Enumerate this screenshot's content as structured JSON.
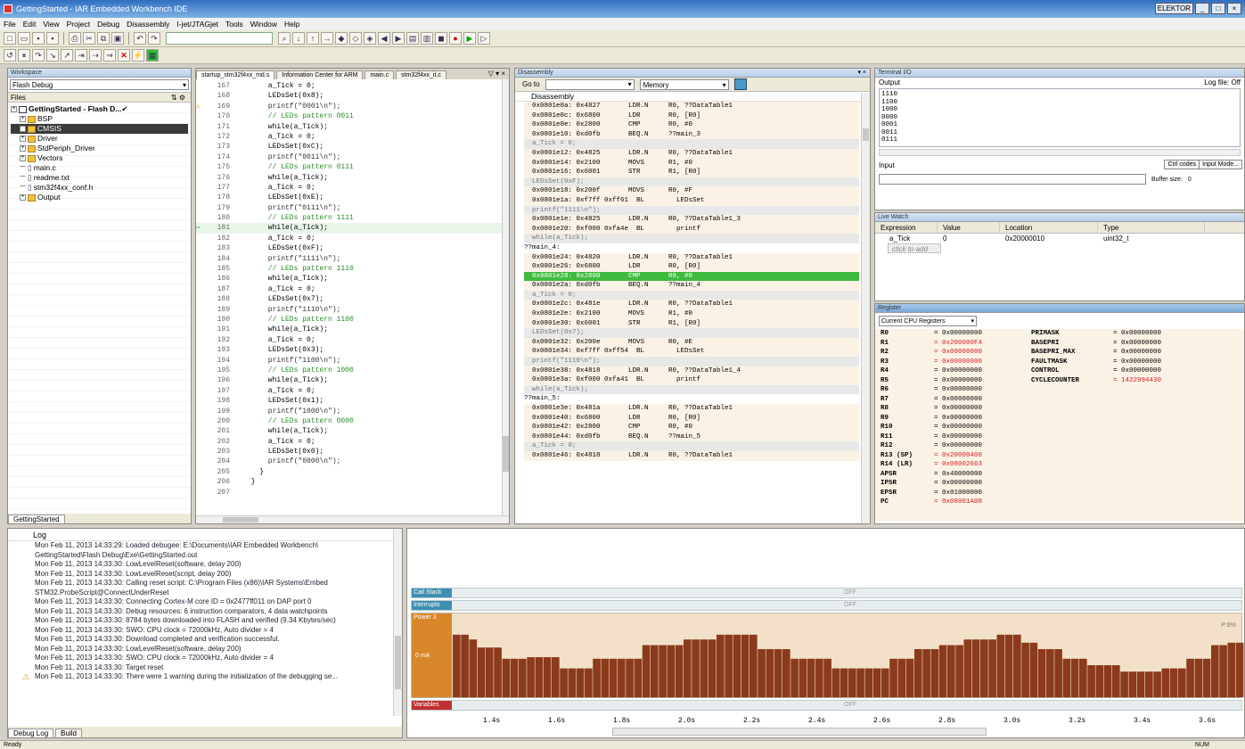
{
  "window": {
    "title": "GettingStarted - IAR Embedded Workbench IDE",
    "title_right": "ELEKTOR"
  },
  "menu": [
    "File",
    "Edit",
    "View",
    "Project",
    "Debug",
    "Disassembly",
    "I-jet/JTAGjet",
    "Tools",
    "Window",
    "Help"
  ],
  "workspace": {
    "title": "Workspace",
    "config": "Flash Debug",
    "files_label": "Files",
    "tree": [
      {
        "label": "GettingStarted - Flash D...",
        "level": 0,
        "type": "project"
      },
      {
        "label": "BSP",
        "level": 1,
        "type": "folder"
      },
      {
        "label": "CMSIS",
        "level": 1,
        "type": "folder",
        "selected": true
      },
      {
        "label": "Driver",
        "level": 1,
        "type": "folder"
      },
      {
        "label": "StdPeriph_Driver",
        "level": 1,
        "type": "folder"
      },
      {
        "label": "Vectors",
        "level": 1,
        "type": "folder"
      },
      {
        "label": "main.c",
        "level": 1,
        "type": "file"
      },
      {
        "label": "readme.txt",
        "level": 1,
        "type": "file"
      },
      {
        "label": "stm32f4xx_conf.h",
        "level": 1,
        "type": "file"
      },
      {
        "label": "Output",
        "level": 1,
        "type": "folder"
      }
    ],
    "tab": "GettingStarted"
  },
  "editor": {
    "tabs": [
      "startup_stm32f4xx_md.s",
      "Information Center for ARM",
      "main.c",
      "stm32f4xx_it.c"
    ],
    "lines": [
      {
        "n": "167",
        "code": "      a_Tick = 0;"
      },
      {
        "n": "168",
        "code": "      LEDsSet(0x8);"
      },
      {
        "n": "169",
        "code": "      printf(\"0001\\n\");",
        "marker": "warn"
      },
      {
        "n": "170",
        "code": "      // LEDs pattern 0011"
      },
      {
        "n": "171",
        "code": "      while(a_Tick);"
      },
      {
        "n": "172",
        "code": "      a_Tick = 0;"
      },
      {
        "n": "173",
        "code": "      LEDsSet(0xC);"
      },
      {
        "n": "174",
        "code": "      printf(\"0011\\n\");"
      },
      {
        "n": "175",
        "code": "      // LEDs pattern 0111"
      },
      {
        "n": "176",
        "code": "      while(a_Tick);"
      },
      {
        "n": "177",
        "code": "      a_Tick = 0;"
      },
      {
        "n": "178",
        "code": "      LEDsSet(0xE);"
      },
      {
        "n": "179",
        "code": "      printf(\"0111\\n\");"
      },
      {
        "n": "180",
        "code": "      // LEDs pattern 1111"
      },
      {
        "n": "181",
        "code": "      while(a_Tick);",
        "marker": "pc"
      },
      {
        "n": "182",
        "code": "      a_Tick = 0;"
      },
      {
        "n": "183",
        "code": "      LEDsSet(0xF);"
      },
      {
        "n": "184",
        "code": "      printf(\"1111\\n\");"
      },
      {
        "n": "185",
        "code": "      // LEDs pattern 1110"
      },
      {
        "n": "186",
        "code": "      while(a_Tick);"
      },
      {
        "n": "187",
        "code": "      a_Tick = 0;"
      },
      {
        "n": "188",
        "code": "      LEDsSet(0x7);"
      },
      {
        "n": "189",
        "code": "      printf(\"1110\\n\");"
      },
      {
        "n": "190",
        "code": "      // LEDs pattern 1100"
      },
      {
        "n": "191",
        "code": "      while(a_Tick);"
      },
      {
        "n": "192",
        "code": "      a_Tick = 0;"
      },
      {
        "n": "193",
        "code": "      LEDsSet(0x3);"
      },
      {
        "n": "194",
        "code": "      printf(\"1100\\n\");"
      },
      {
        "n": "195",
        "code": "      // LEDs pattern 1000"
      },
      {
        "n": "196",
        "code": "      while(a_Tick);"
      },
      {
        "n": "197",
        "code": "      a_Tick = 0;"
      },
      {
        "n": "198",
        "code": "      LEDsSet(0x1);"
      },
      {
        "n": "199",
        "code": "      printf(\"1000\\n\");"
      },
      {
        "n": "200",
        "code": "      // LEDs pattern 0000"
      },
      {
        "n": "201",
        "code": "      while(a_Tick);"
      },
      {
        "n": "202",
        "code": "      a_Tick = 0;"
      },
      {
        "n": "203",
        "code": "      LEDsSet(0x0);"
      },
      {
        "n": "204",
        "code": "      printf(\"0000\\n\");"
      },
      {
        "n": "205",
        "code": "    }"
      },
      {
        "n": "206",
        "code": "  }"
      },
      {
        "n": "207",
        "code": ""
      }
    ]
  },
  "disassembly": {
    "title": "Disassembly",
    "goto_label": "Go to",
    "memory_label": "Memory",
    "header": "Disassembly",
    "lines": [
      {
        "t": "asm",
        "text": "  0x0801e0a: 0x4827       LDR.N     R0, ??DataTable1"
      },
      {
        "t": "asm",
        "text": "  0x0801e0c: 0x6800       LDR       R0, [R0]"
      },
      {
        "t": "asm",
        "text": "  0x0801e0e: 0x2800       CMP       R0, #0"
      },
      {
        "t": "asm",
        "text": "  0x0801e10: 0xd0fb       BEQ.N     ??main_3"
      },
      {
        "t": "src",
        "text": "  a_Tick = 0;"
      },
      {
        "t": "asm",
        "text": "  0x0801e12: 0x4825       LDR.N     R0, ??DataTable1"
      },
      {
        "t": "asm",
        "text": "  0x0801e14: 0x2100       MOVS      R1, #0"
      },
      {
        "t": "asm",
        "text": "  0x0801e16: 0x6001       STR       R1, [R0]"
      },
      {
        "t": "src",
        "text": "  LEDsSet(0xF);"
      },
      {
        "t": "asm",
        "text": "  0x0801e18: 0x200f       MOVS      R0, #F"
      },
      {
        "t": "asm",
        "text": "  0x0801e1a: 0xf7ff 0xff61  BL        LEDsSet"
      },
      {
        "t": "src",
        "text": "  printf(\"1111\\n\");"
      },
      {
        "t": "asm",
        "text": "  0x0801e1e: 0x4825       LDR.N     R0, ??DataTable1_3"
      },
      {
        "t": "asm",
        "text": "  0x0801e20: 0xf000 0xfa4e  BL        printf"
      },
      {
        "t": "src",
        "text": "  while(a_Tick);"
      },
      {
        "t": "lbl",
        "text": "??main_4:"
      },
      {
        "t": "asm",
        "text": "  0x0801e24: 0x4820       LDR.N     R0, ??DataTable1"
      },
      {
        "t": "asm",
        "text": "  0x0801e26: 0x6800       LDR       R0, [R0]"
      },
      {
        "t": "hl",
        "text": "  0x0801e28: 0x2800       CMP       R0, #0"
      },
      {
        "t": "asm",
        "text": "  0x0801e2a: 0xd0fb       BEQ.N     ??main_4"
      },
      {
        "t": "src",
        "text": "  a_Tick = 0;"
      },
      {
        "t": "asm",
        "text": "  0x0801e2c: 0x481e       LDR.N     R0, ??DataTable1"
      },
      {
        "t": "asm",
        "text": "  0x0801e2e: 0x2100       MOVS      R1, #0"
      },
      {
        "t": "asm",
        "text": "  0x0801e30: 0x6001       STR       R1, [R0]"
      },
      {
        "t": "src",
        "text": "  LEDsSet(0x7);"
      },
      {
        "t": "asm",
        "text": "  0x0801e32: 0x200e       MOVS      R0, #E"
      },
      {
        "t": "asm",
        "text": "  0x0801e34: 0xf7ff 0xff54  BL        LEDsSet"
      },
      {
        "t": "src",
        "text": "  printf(\"1110\\n\");"
      },
      {
        "t": "asm",
        "text": "  0x0801e38: 0x4818       LDR.N     R0, ??DataTable1_4"
      },
      {
        "t": "asm",
        "text": "  0x0801e3a: 0xf000 0xfa41  BL        printf"
      },
      {
        "t": "src",
        "text": "  while(a_Tick);"
      },
      {
        "t": "lbl",
        "text": "??main_5:"
      },
      {
        "t": "asm",
        "text": "  0x0801e3e: 0x481a       LDR.N     R0, ??DataTable1"
      },
      {
        "t": "asm",
        "text": "  0x0801e40: 0x6800       LDR       R0, [R0]"
      },
      {
        "t": "asm",
        "text": "  0x0801e42: 0x2800       CMP       R0, #0"
      },
      {
        "t": "asm",
        "text": "  0x0801e44: 0xd0fb       BEQ.N     ??main_5"
      },
      {
        "t": "src",
        "text": "  a_Tick = 0;"
      },
      {
        "t": "asm",
        "text": "  0x0801e46: 0x4818       LDR.N     R0, ??DataTable1"
      }
    ]
  },
  "terminal": {
    "title": "Terminal I/O",
    "output_label": "Output",
    "log_file": "Log file: Off",
    "output_lines": [
      "1110",
      "1100",
      "1000",
      "0000",
      "0001",
      "0011",
      "0111"
    ],
    "input_label": "Input",
    "ctrl_codes": "Ctrl codes",
    "input_mode": "Input Mode...",
    "buffer_label": "Buffer size:",
    "buffer_value": "0"
  },
  "livewatch": {
    "title": "Live Watch",
    "headers": [
      "Expression",
      "Value",
      "Location",
      "Type"
    ],
    "rows": [
      {
        "expr": "a_Tick",
        "value": "0",
        "location": "0x20000010",
        "type": "uint32_t"
      }
    ],
    "placeholder": "click to add"
  },
  "registers": {
    "title": "Register",
    "group": "Current CPU Registers",
    "left": [
      {
        "name": "R0",
        "val": "= 0x00000000",
        "changed": false
      },
      {
        "name": "R1",
        "val": "= 0x200000F4",
        "changed": true
      },
      {
        "name": "R2",
        "val": "= 0x00000000",
        "changed": true
      },
      {
        "name": "R3",
        "val": "= 0x00000000",
        "changed": true
      },
      {
        "name": "R4",
        "val": "= 0x00000000",
        "changed": false
      },
      {
        "name": "R5",
        "val": "= 0x00000000",
        "changed": false
      },
      {
        "name": "R6",
        "val": "= 0x00000000",
        "changed": false
      },
      {
        "name": "R7",
        "val": "= 0x00000000",
        "changed": false
      },
      {
        "name": "R8",
        "val": "= 0x00000000",
        "changed": false
      },
      {
        "name": "R9",
        "val": "= 0x00000000",
        "changed": false
      },
      {
        "name": "R10",
        "val": "= 0x00000000",
        "changed": false
      },
      {
        "name": "R11",
        "val": "= 0x00000000",
        "changed": false
      },
      {
        "name": "R12",
        "val": "= 0x00000000",
        "changed": false
      },
      {
        "name": "R13 (SP)",
        "val": "= 0x20000400",
        "changed": true
      },
      {
        "name": "R14 (LR)",
        "val": "= 0x08002663",
        "changed": true
      },
      {
        "name": "APSR",
        "val": "= 0x40000000",
        "changed": false
      },
      {
        "name": "IPSR",
        "val": "= 0x00000000",
        "changed": false
      },
      {
        "name": "EPSR",
        "val": "= 0x01000000",
        "changed": false
      },
      {
        "name": "PC",
        "val": "= 0x08001A08",
        "changed": true
      }
    ],
    "right": [
      {
        "name": "PRIMASK",
        "val": "= 0x00000000",
        "changed": false
      },
      {
        "name": "BASEPRI",
        "val": "= 0x00000000",
        "changed": false
      },
      {
        "name": "BASEPRI_MAX",
        "val": "= 0x00000000",
        "changed": false
      },
      {
        "name": "FAULTMASK",
        "val": "= 0x00000000",
        "changed": false
      },
      {
        "name": "CONTROL",
        "val": "= 0x00000000",
        "changed": false
      },
      {
        "name": "CYCLECOUNTER",
        "val": "= 1422994430",
        "changed": true
      }
    ]
  },
  "log": {
    "title": "Log",
    "lines": [
      "Mon Feb 11, 2013 14:33:29: Loaded debugee: E:\\Documents\\IAR Embedded Workbench\\",
      "GettingStarted\\Flash Debug\\Exe\\GettingStarted.out",
      "Mon Feb 11, 2013 14:33:30: LowLevelReset(software, delay 200)",
      "Mon Feb 11, 2013 14:33:30: LowLevelReset(script, delay 200)",
      "Mon Feb 11, 2013 14:33:30: Calling reset script: C:\\Program Files (x86)\\IAR Systems\\Embed",
      "STM32.ProbeScript@ConnectUnderReset",
      "Mon Feb 11, 2013 14:33:30: Connecting Cortex-M core ID = 0x2477ff011 on DAP port 0",
      "Mon Feb 11, 2013 14:33:30: Debug resources: 6 instruction comparators, 4 data watchpoints",
      "Mon Feb 11, 2013 14:33:30: 8784 bytes downloaded into FLASH and verified (9.34 Kbytes/sec)",
      "Mon Feb 11, 2013 14:33:30: SWO: CPU clock = 72000kHz, Auto divider = 4",
      "Mon Feb 11, 2013 14:33:30: Download completed and verification successful.",
      "Mon Feb 11, 2013 14:33:30: LowLevelReset(software, delay 200)",
      "Mon Feb 11, 2013 14:33:30: SWO: CPU clock = 72000kHz, Auto divider = 4",
      "Mon Feb 11, 2013 14:33:30: Target reset",
      "Mon Feb 11, 2013 14:33:30: There were 1 warning during the initialization of the debugging se..."
    ],
    "tabs": [
      "Debug Log",
      "Build"
    ]
  },
  "timeline": {
    "rows": [
      {
        "label": "Call Stack",
        "value": "OFF"
      },
      {
        "label": "Interrupts",
        "value": "OFF"
      },
      {
        "label": "Power",
        "value": ""
      },
      {
        "label": "Variables",
        "value": "OFF"
      }
    ],
    "power_top_label": "Power  3",
    "power_side_label": "0 mA",
    "power_right_label": "P:6%",
    "ticks": [
      "1.4s",
      "1.6s",
      "1.8s",
      "2.0s",
      "2.2s",
      "2.4s",
      "2.6s",
      "2.8s",
      "3.0s",
      "3.2s",
      "3.4s",
      "3.6s"
    ]
  },
  "power_levels": [
    0.78,
    0.78,
    0.72,
    0.62,
    0.62,
    0.62,
    0.48,
    0.48,
    0.48,
    0.5,
    0.5,
    0.5,
    0.5,
    0.36,
    0.36,
    0.36,
    0.36,
    0.48,
    0.48,
    0.48,
    0.48,
    0.48,
    0.48,
    0.65,
    0.65,
    0.65,
    0.65,
    0.65,
    0.72,
    0.72,
    0.72,
    0.72,
    0.78,
    0.78,
    0.78,
    0.78,
    0.78,
    0.6,
    0.6,
    0.6,
    0.6,
    0.48,
    0.48,
    0.48,
    0.48,
    0.48,
    0.36,
    0.36,
    0.36,
    0.36,
    0.36,
    0.36,
    0.36,
    0.48,
    0.48,
    0.48,
    0.6,
    0.6,
    0.6,
    0.65,
    0.65,
    0.65,
    0.72,
    0.72,
    0.72,
    0.72,
    0.78,
    0.78,
    0.78,
    0.68,
    0.68,
    0.6,
    0.6,
    0.6,
    0.48,
    0.48,
    0.48,
    0.4,
    0.4,
    0.4,
    0.4,
    0.32,
    0.32,
    0.32,
    0.32,
    0.32,
    0.36,
    0.36,
    0.36,
    0.48,
    0.48,
    0.48,
    0.65,
    0.65,
    0.68,
    0.68
  ],
  "statusbar": {
    "left": "Ready",
    "right": "NUM"
  },
  "colors": {
    "bar": "#8b3a1c",
    "power_bg": "#f3e0c8",
    "row_label": "#3f8fb3",
    "highlight": "#3fba3f",
    "changed_reg": "#d22020"
  }
}
